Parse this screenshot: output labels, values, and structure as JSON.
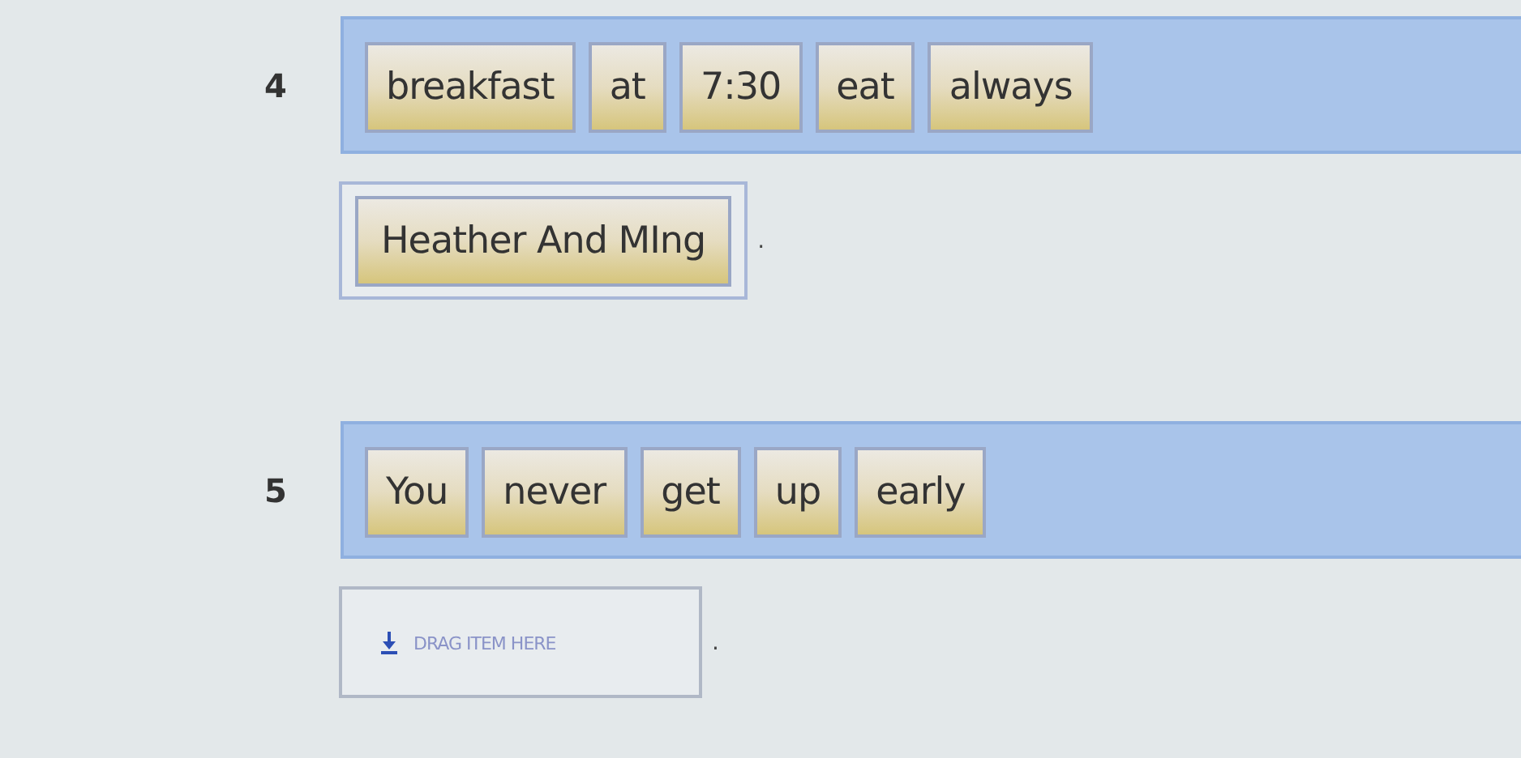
{
  "questions": [
    {
      "number": "4",
      "word_bank": [
        "breakfast",
        "at",
        "7:30",
        "eat",
        "always"
      ],
      "answer": {
        "tiles": [
          "Heather And MIng"
        ]
      },
      "end_mark": "."
    },
    {
      "number": "5",
      "word_bank": [
        "You",
        "never",
        "get",
        "up",
        "early"
      ],
      "answer": {
        "placeholder": "DRAG ITEM HERE"
      },
      "end_mark": "."
    }
  ]
}
